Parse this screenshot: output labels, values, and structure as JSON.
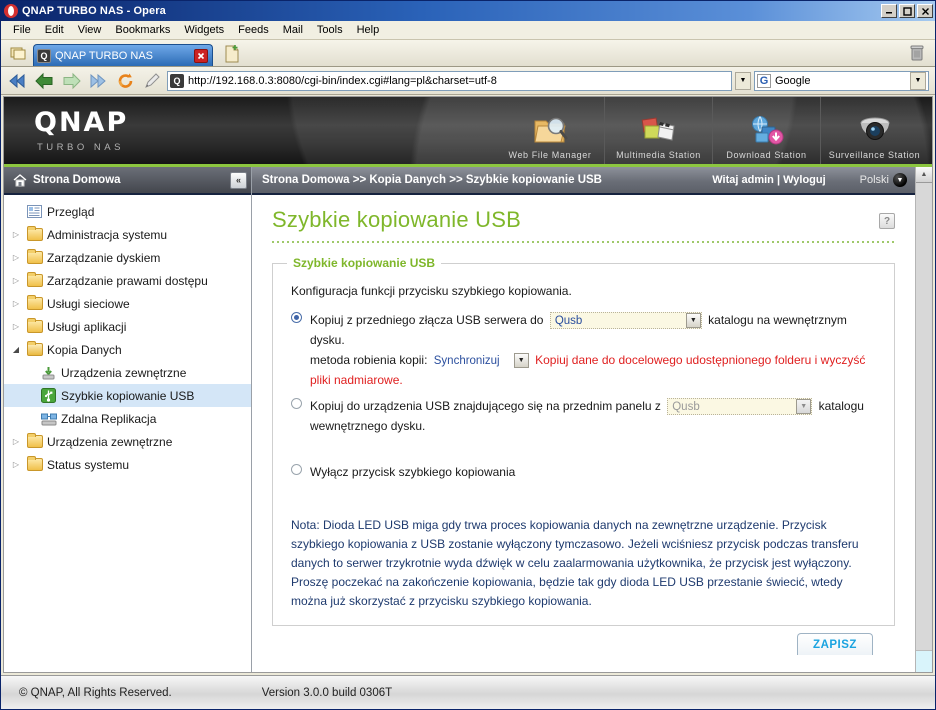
{
  "window": {
    "title": "QNAP TURBO NAS - Opera",
    "app_icon": "opera-icon",
    "minimize_label": "_",
    "maximize_label": "❐",
    "close_label": "✕"
  },
  "menubar": {
    "items": [
      "File",
      "Edit",
      "View",
      "Bookmarks",
      "Widgets",
      "Feeds",
      "Mail",
      "Tools",
      "Help"
    ]
  },
  "tabbar": {
    "panel_toggle_icon": "panels-icon",
    "tab": {
      "favicon": "qnap-favicon",
      "title": "QNAP TURBO NAS",
      "close_label": "✕"
    },
    "new_tab_icon": "new-page-icon",
    "trash_icon": "trash-icon"
  },
  "addressbar": {
    "rewind_icon": "rewind-icon",
    "back_icon": "back-arrow-icon",
    "forward_icon": "forward-arrow-icon",
    "fastforward_icon": "fast-forward-icon",
    "reload_icon": "reload-icon",
    "edit_icon": "pencil-icon",
    "url_favicon": "qnap-favicon",
    "url": "http://192.168.0.3:8080/cgi-bin/index.cgi#lang=pl&charset=utf-8",
    "url_dropdown_label": "▼",
    "search": {
      "engine_icon": "google-icon",
      "engine_letter": "G",
      "value": "Google",
      "dropdown_label": "▼"
    }
  },
  "banner": {
    "logo": "QNAP",
    "subtitle": "TURBO NAS",
    "stations": [
      {
        "label": "Web File Manager",
        "icon": "web-file-manager-icon"
      },
      {
        "label": "Multimedia Station",
        "icon": "multimedia-station-icon"
      },
      {
        "label": "Download Station",
        "icon": "download-station-icon"
      },
      {
        "label": "Surveillance Station",
        "icon": "surveillance-station-icon"
      }
    ]
  },
  "sidebar": {
    "header": {
      "icon": "home-icon",
      "title": "Strona Domowa",
      "collapse_label": "«"
    },
    "items": [
      {
        "label": "Przegląd",
        "icon": "overview-icon",
        "twisty": "",
        "level": 0,
        "selected": false
      },
      {
        "label": "Administracja systemu",
        "icon": "folder-icon",
        "twisty": "▷",
        "level": 0,
        "selected": false
      },
      {
        "label": "Zarządzanie dyskiem",
        "icon": "folder-icon",
        "twisty": "▷",
        "level": 0,
        "selected": false
      },
      {
        "label": "Zarządzanie prawami dostępu",
        "icon": "folder-icon",
        "twisty": "▷",
        "level": 0,
        "selected": false
      },
      {
        "label": "Usługi sieciowe",
        "icon": "folder-icon",
        "twisty": "▷",
        "level": 0,
        "selected": false
      },
      {
        "label": "Usługi aplikacji",
        "icon": "folder-icon",
        "twisty": "▷",
        "level": 0,
        "selected": false
      },
      {
        "label": "Kopia Danych",
        "icon": "folder-open-icon",
        "twisty": "◢",
        "level": 0,
        "selected": false
      },
      {
        "label": "Urządzenia zewnętrzne",
        "icon": "external-device-icon",
        "twisty": "",
        "level": 1,
        "selected": false
      },
      {
        "label": "Szybkie kopiowanie USB",
        "icon": "usb-icon",
        "twisty": "",
        "level": 1,
        "selected": true
      },
      {
        "label": "Zdalna Replikacja",
        "icon": "replication-icon",
        "twisty": "",
        "level": 1,
        "selected": false
      },
      {
        "label": "Urządzenia zewnętrzne",
        "icon": "folder-icon",
        "twisty": "▷",
        "level": 0,
        "selected": false
      },
      {
        "label": "Status systemu",
        "icon": "folder-icon",
        "twisty": "▷",
        "level": 0,
        "selected": false
      }
    ]
  },
  "breadcrumb": {
    "path": "Strona Domowa >> Kopia Danych >> Szybkie kopiowanie USB",
    "greeting": "Witaj admin | Wyloguj",
    "language": "Polski",
    "language_arrow": "▼"
  },
  "main": {
    "page_title": "Szybkie kopiowanie USB",
    "help_label": "?",
    "fieldset_legend": "Szybkie kopiowanie USB",
    "lead": "Konfiguracja funkcji przycisku szybkiego kopiowania.",
    "options": [
      {
        "selected": true,
        "text_before": "Kopiuj z przedniego złącza USB serwera do",
        "select_value": "Qusb",
        "select_arrow": "▼",
        "text_after": "katalogu na wewnętrznym dysku.",
        "method_label": "metoda robienia kopii:",
        "method_value": "Synchronizuj",
        "method_arrow": "▼",
        "warning": "Kopiuj dane do docelowego udostępnionego folderu i wyczyść pliki nadmiarowe."
      },
      {
        "selected": false,
        "text_before": "Kopiuj do urządzenia USB znajdującego się na przednim panelu z",
        "select_value": "Qusb",
        "select_arrow": "▼",
        "text_after": "katalogu wewnętrznego dysku."
      },
      {
        "selected": false,
        "text_before": "Wyłącz przycisk szybkiego kopiowania"
      }
    ],
    "note": "Nota: Dioda LED USB miga gdy trwa proces kopiowania danych na zewnętrzne urządzenie. Przycisk szybkiego kopiowania z USB zostanie wyłączony tymczasowo. Jeżeli wciśniesz przycisk podczas transferu danych to serwer trzykrotnie wyda dźwięk w celu zaalarmowania użytkownika, że przycisk jest wyłączony. Proszę poczekać na zakończenie kopiowania, będzie tak gdy dioda LED USB przestanie świecić, wtedy można już skorzystać z przycisku szybkiego kopiowania.",
    "save_label": "ZAPISZ"
  },
  "footer": {
    "copyright": "© QNAP, All Rights Reserved.",
    "version": "Version 3.0.0 build 0306T"
  },
  "colors": {
    "qnap_green": "#7fb72b",
    "accent_blue": "#1aa3e0",
    "warning_red": "#e02020",
    "note_blue": "#1e3a6e",
    "selection_blue": "#d4e6f7"
  }
}
